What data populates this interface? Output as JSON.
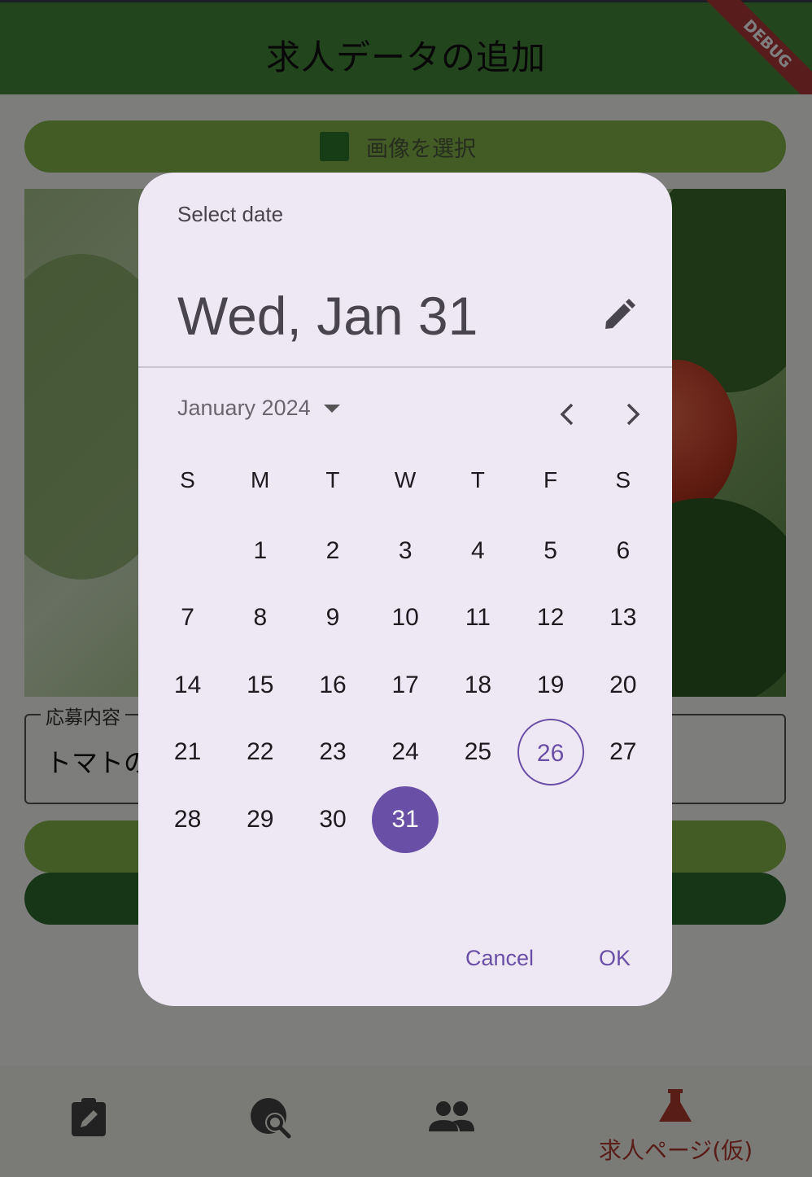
{
  "app": {
    "title": "求人データの追加",
    "debug_banner": "DEBUG",
    "select_image_label": "画像を選択",
    "field_label": "応募内容",
    "field_value": "トマトの"
  },
  "bottom_nav": {
    "items": [
      {
        "icon": "edit-clipboard-icon",
        "label": ""
      },
      {
        "icon": "travel-explore-icon",
        "label": ""
      },
      {
        "icon": "people-icon",
        "label": ""
      },
      {
        "icon": "flask-icon",
        "label": "求人ページ(仮)"
      }
    ],
    "active_color": "#b33a2e"
  },
  "date_picker": {
    "help_text": "Select date",
    "headline": "Wed, Jan 31",
    "month_year": "January 2024",
    "weekdays": [
      "S",
      "M",
      "T",
      "W",
      "T",
      "F",
      "S"
    ],
    "first_weekday_offset": 1,
    "days_in_month": 31,
    "today": 26,
    "selected": 31,
    "cancel_label": "Cancel",
    "ok_label": "OK",
    "accent_color": "#6a4fa6"
  }
}
